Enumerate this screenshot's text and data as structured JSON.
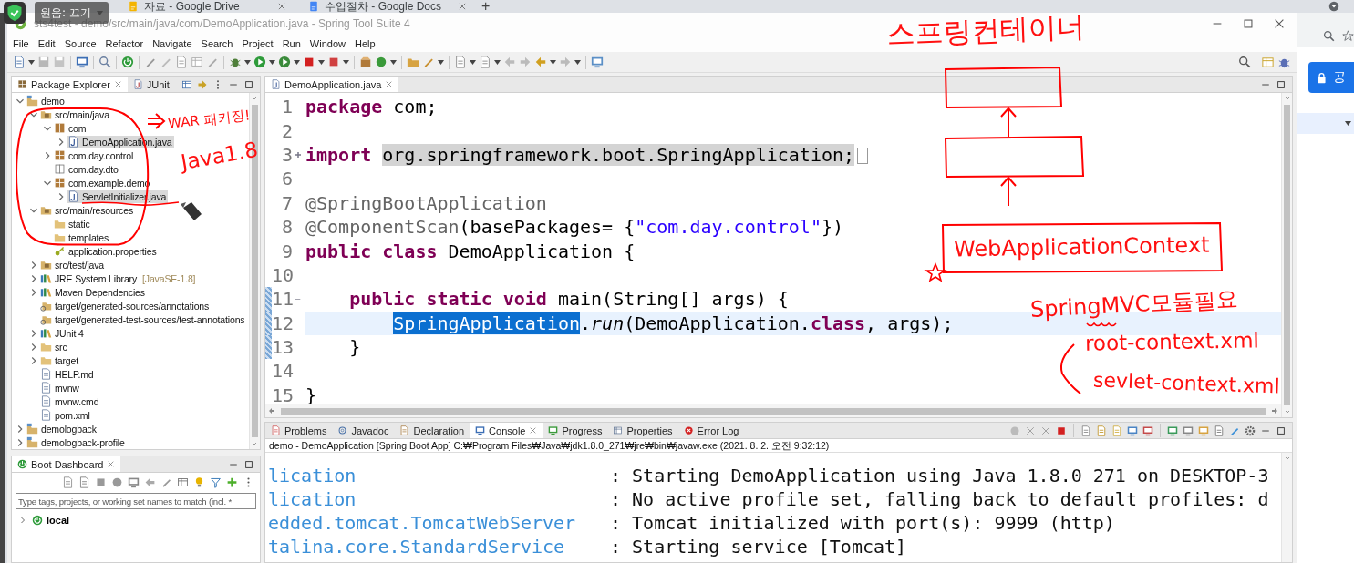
{
  "browser": {
    "tabs": [
      {
        "title": "자료 - Google Drive",
        "selected": false
      },
      {
        "title": "수업절차 - Google Docs",
        "selected": false
      }
    ],
    "new_tab": "+",
    "overlay_badge": "원음: 끄기",
    "side_button": "공"
  },
  "window": {
    "title": "sts4test - demo/src/main/java/com/DemoApplication.java - Spring Tool Suite 4"
  },
  "menu": [
    "File",
    "Edit",
    "Source",
    "Refactor",
    "Navigate",
    "Search",
    "Project",
    "Run",
    "Window",
    "Help"
  ],
  "package_explorer": {
    "tabs": [
      {
        "label": "Package Explorer",
        "selected": true
      },
      {
        "label": "JUnit",
        "selected": false
      }
    ],
    "tree": [
      {
        "label": "demo",
        "kind": "project",
        "expanded": true,
        "selected": false,
        "children": [
          {
            "label": "src/main/java",
            "kind": "source-folder",
            "expanded": true,
            "selected": false,
            "children": [
              {
                "label": "com",
                "kind": "package",
                "expanded": true,
                "selected": false,
                "children": [
                  {
                    "label": "DemoApplication.java",
                    "kind": "java-file",
                    "expanded": false,
                    "selected": true
                  }
                ]
              },
              {
                "label": "com.day.control",
                "kind": "package",
                "expanded": false,
                "selected": false
              },
              {
                "label": "com.day.dto",
                "kind": "empty-package",
                "selected": false
              },
              {
                "label": "com.example.demo",
                "kind": "package",
                "expanded": true,
                "selected": false,
                "children": [
                  {
                    "label": "ServletInitializer.java",
                    "kind": "java-file",
                    "expanded": false,
                    "selected": true
                  }
                ]
              }
            ]
          },
          {
            "label": "src/main/resources",
            "kind": "source-folder",
            "expanded": true,
            "selected": false,
            "children": [
              {
                "label": "static",
                "kind": "folder",
                "selected": false
              },
              {
                "label": "templates",
                "kind": "folder",
                "selected": false
              },
              {
                "label": "application.properties",
                "kind": "properties",
                "selected": false
              }
            ]
          },
          {
            "label": "src/test/java",
            "kind": "source-folder",
            "expanded": false,
            "selected": false
          },
          {
            "label": "JRE System Library",
            "decoration": "[JavaSE-1.8]",
            "kind": "library",
            "expanded": false,
            "selected": false
          },
          {
            "label": "Maven Dependencies",
            "kind": "library",
            "expanded": false,
            "selected": false
          },
          {
            "label": "target/generated-sources/annotations",
            "kind": "linked-folder",
            "selected": false
          },
          {
            "label": "target/generated-test-sources/test-annotations",
            "kind": "linked-folder",
            "selected": false
          },
          {
            "label": "JUnit 4",
            "kind": "library",
            "expanded": false,
            "selected": false
          },
          {
            "label": "src",
            "kind": "folder",
            "expanded": false,
            "selected": false
          },
          {
            "label": "target",
            "kind": "folder",
            "expanded": false,
            "selected": false
          },
          {
            "label": "HELP.md",
            "kind": "file",
            "selected": false
          },
          {
            "label": "mvnw",
            "kind": "file",
            "selected": false
          },
          {
            "label": "mvnw.cmd",
            "kind": "file",
            "selected": false
          },
          {
            "label": "pom.xml",
            "kind": "file",
            "selected": false
          }
        ]
      },
      {
        "label": "demologback",
        "kind": "project",
        "expanded": false,
        "selected": false
      },
      {
        "label": "demologback-profile",
        "kind": "project",
        "expanded": false,
        "selected": false
      }
    ]
  },
  "boot_dashboard": {
    "title": "Boot Dashboard",
    "filter_placeholder": "Type tags, projects, or working set names to match (incl. *",
    "items": [
      {
        "label": "local",
        "expanded": false
      }
    ]
  },
  "editor": {
    "tabs": [
      {
        "label": "DemoApplication.java",
        "selected": true
      }
    ],
    "lines": [
      {
        "number": "1",
        "current": false,
        "marked": false,
        "tokens": [
          {
            "kind": "keyword",
            "text": "package"
          },
          {
            "kind": "plain",
            "text": "com;"
          }
        ]
      },
      {
        "number": "2",
        "current": false,
        "marked": false
      },
      {
        "number": "3",
        "current": false,
        "marked": false,
        "collapsed": true,
        "tokens": [
          {
            "kind": "keyword",
            "text": "import"
          },
          {
            "kind": "occurrence",
            "text": "org.springframework.boot.SpringApplication;"
          }
        ]
      },
      {
        "number": "6",
        "current": false,
        "marked": false
      },
      {
        "number": "7",
        "current": false,
        "marked": false,
        "tokens": [
          {
            "kind": "annotation",
            "text": "@SpringBootApplication"
          }
        ]
      },
      {
        "number": "8",
        "current": false,
        "marked": false,
        "tokens": [
          {
            "kind": "annotation",
            "text": "@ComponentScan"
          },
          {
            "kind": "plain",
            "text": "(basePackages= {"
          },
          {
            "kind": "string",
            "text": "\"com.day.control\""
          },
          {
            "kind": "plain",
            "text": "})"
          }
        ]
      },
      {
        "number": "9",
        "current": false,
        "marked": false,
        "tokens": [
          {
            "kind": "keyword",
            "text": "public"
          },
          {
            "kind": "keyword",
            "text": "class"
          },
          {
            "kind": "plain",
            "text": "DemoApplication {"
          }
        ]
      },
      {
        "number": "10",
        "current": false,
        "marked": false
      },
      {
        "number": "11",
        "current": false,
        "marked": true,
        "collapsed": false,
        "tokens": [
          {
            "kind": "keyword",
            "text": "public"
          },
          {
            "kind": "keyword",
            "text": "static"
          },
          {
            "kind": "keyword",
            "text": "void"
          },
          {
            "kind": "plain",
            "text": "main(String[] args) {"
          }
        ]
      },
      {
        "number": "12",
        "current": true,
        "marked": true,
        "tokens": [
          {
            "kind": "selection",
            "text": "SpringApplication"
          },
          {
            "kind": "plain",
            "text": "."
          },
          {
            "kind": "italic",
            "text": "run"
          },
          {
            "kind": "plain",
            "text": "(DemoApplication."
          },
          {
            "kind": "keyword",
            "text": "class"
          },
          {
            "kind": "plain",
            "text": ", args);"
          }
        ]
      },
      {
        "number": "13",
        "current": false,
        "marked": true,
        "tokens": [
          {
            "kind": "plain",
            "text": "}"
          }
        ]
      },
      {
        "number": "14",
        "current": false,
        "marked": false
      },
      {
        "number": "15",
        "current": false,
        "marked": false,
        "tokens": [
          {
            "kind": "plain",
            "text": "}"
          }
        ]
      }
    ]
  },
  "console": {
    "tabs": [
      {
        "label": "Problems",
        "selected": false
      },
      {
        "label": "Javadoc",
        "selected": false
      },
      {
        "label": "Declaration",
        "selected": false
      },
      {
        "label": "Console",
        "selected": true
      },
      {
        "label": "Progress",
        "selected": false
      },
      {
        "label": "Properties",
        "selected": false
      },
      {
        "label": "Error Log",
        "selected": false
      }
    ],
    "description": "demo - DemoApplication [Spring Boot App] C:₩Program Files₩Java₩jdk1.8.0_271₩jre₩bin₩javaw.exe  (2021. 8. 2. 오전 9:32:12)",
    "lines": [
      {
        "source": "lication",
        "message": ": Starting DemoApplication using Java 1.8.0_271 on DESKTOP-3"
      },
      {
        "source": "lication",
        "message": ": No active profile set, falling back to default profiles: d"
      },
      {
        "source": "edded.tomcat.TomcatWebServer",
        "message": ": Tomcat initialized with port(s): 9999 (http)"
      },
      {
        "source": "talina.core.StandardService",
        "message": ": Starting service [Tomcat]"
      }
    ]
  },
  "annotations": [
    {
      "text": "스프링컨테이너"
    },
    {
      "text": "WAR 패키징!"
    },
    {
      "text": "Java1.8"
    },
    {
      "text": "WebApplicationContext"
    },
    {
      "text": "SpringMVC모듈필요"
    },
    {
      "text": "root-context.xml"
    },
    {
      "text": "sevlet-context.xml"
    }
  ]
}
